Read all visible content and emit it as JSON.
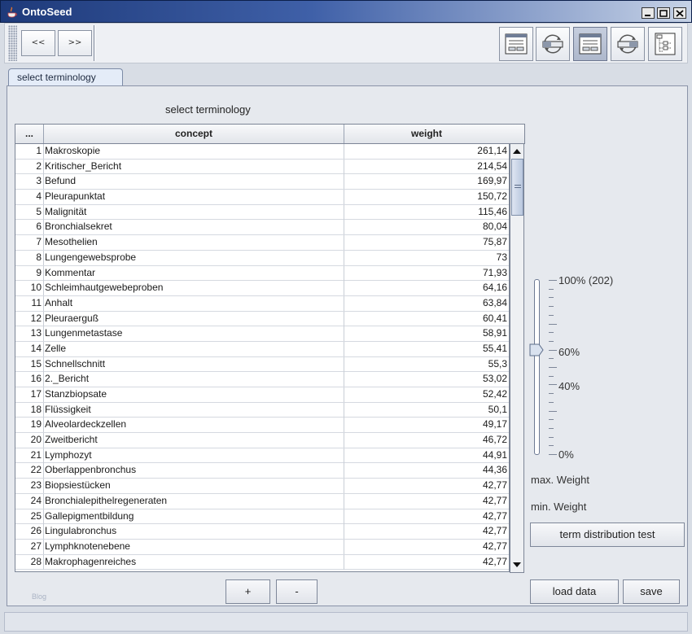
{
  "window": {
    "title": "OntoSeed"
  },
  "toolbar": {
    "back_label": "<<",
    "forward_label": ">>",
    "icons": [
      "view-form-icon",
      "refresh-cycle-icon",
      "view-form-active-icon",
      "refresh-cycle-icon",
      "tree-structure-icon"
    ]
  },
  "tab": {
    "label": "select terminology"
  },
  "panel": {
    "caption": "select terminology",
    "blog_text": "Blog"
  },
  "table": {
    "columns": [
      "...",
      "concept",
      "weight"
    ],
    "rows": [
      {
        "n": "1",
        "concept": "Makroskopie",
        "weight": "261,14"
      },
      {
        "n": "2",
        "concept": "Kritischer_Bericht",
        "weight": "214,54"
      },
      {
        "n": "3",
        "concept": "Befund",
        "weight": "169,97"
      },
      {
        "n": "4",
        "concept": "Pleurapunktat",
        "weight": "150,72"
      },
      {
        "n": "5",
        "concept": "Malignität",
        "weight": "115,46"
      },
      {
        "n": "6",
        "concept": "Bronchialsekret",
        "weight": "80,04"
      },
      {
        "n": "7",
        "concept": "Mesothelien",
        "weight": "75,87"
      },
      {
        "n": "8",
        "concept": "Lungengewebsprobe",
        "weight": "73"
      },
      {
        "n": "9",
        "concept": "Kommentar",
        "weight": "71,93"
      },
      {
        "n": "10",
        "concept": "Schleimhautgewebeproben",
        "weight": "64,16"
      },
      {
        "n": "11",
        "concept": "Anhalt",
        "weight": "63,84"
      },
      {
        "n": "12",
        "concept": "Pleuraerguß",
        "weight": "60,41"
      },
      {
        "n": "13",
        "concept": "Lungenmetastase",
        "weight": "58,91"
      },
      {
        "n": "14",
        "concept": "Zelle",
        "weight": "55,41"
      },
      {
        "n": "15",
        "concept": "Schnellschnitt",
        "weight": "55,3"
      },
      {
        "n": "16",
        "concept": "2._Bericht",
        "weight": "53,02"
      },
      {
        "n": "17",
        "concept": "Stanzbiopsate",
        "weight": "52,42"
      },
      {
        "n": "18",
        "concept": "Flüssigkeit",
        "weight": "50,1"
      },
      {
        "n": "19",
        "concept": "Alveolardeckzellen",
        "weight": "49,17"
      },
      {
        "n": "20",
        "concept": "Zweitbericht",
        "weight": "46,72"
      },
      {
        "n": "21",
        "concept": "Lymphozyt",
        "weight": "44,91"
      },
      {
        "n": "22",
        "concept": "Oberlappenbronchus",
        "weight": "44,36"
      },
      {
        "n": "23",
        "concept": "Biopsiestücken",
        "weight": "42,77"
      },
      {
        "n": "24",
        "concept": "Bronchialepithelregeneraten",
        "weight": "42,77"
      },
      {
        "n": "25",
        "concept": "Gallepigmentbildung",
        "weight": "42,77"
      },
      {
        "n": "26",
        "concept": "Lingulabronchus",
        "weight": "42,77"
      },
      {
        "n": "27",
        "concept": "Lymphknotenebene",
        "weight": "42,77"
      },
      {
        "n": "28",
        "concept": "Makrophagenreiches",
        "weight": "42,77"
      }
    ]
  },
  "slider": {
    "label_max": "100% (202)",
    "label_60": "60%",
    "label_40": "40%",
    "label_min": "0%",
    "value_percent": 60
  },
  "weights": {
    "max_label": "max. Weight",
    "min_label": "min. Weight"
  },
  "buttons": {
    "term_test": "term distribution test",
    "add": "+",
    "remove": "-",
    "load": "load data",
    "save": "save"
  },
  "colors": {
    "titlebar_start": "#1e3a7a",
    "titlebar_end": "#c6d2e6",
    "panel_bg": "#e6e9ee"
  }
}
